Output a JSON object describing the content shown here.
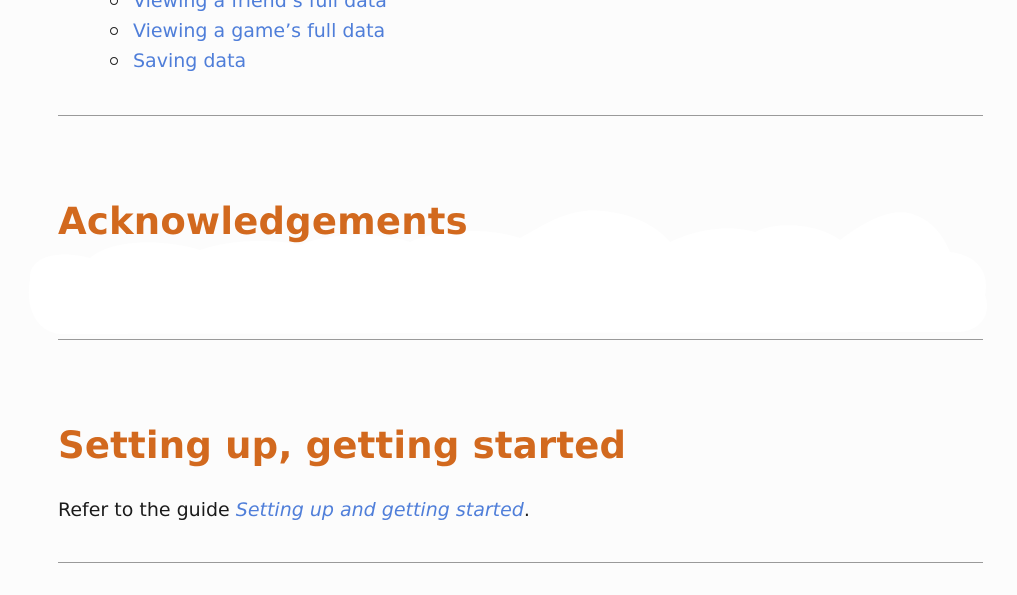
{
  "toc": {
    "items": [
      {
        "label": "Viewing a friend’s full data"
      },
      {
        "label": "Viewing a game’s full data"
      },
      {
        "label": "Saving data"
      }
    ]
  },
  "sections": {
    "acknowledgements": {
      "heading": "Acknowledgements"
    },
    "setup": {
      "heading": "Setting up, getting started",
      "text_before": "Refer to the guide ",
      "link_text": "Setting up and getting started",
      "text_after": "."
    }
  },
  "colors": {
    "heading": "#d2691e",
    "link": "#4f7ed9",
    "rule": "#9a9a9a",
    "background": "#fcfcfc"
  }
}
